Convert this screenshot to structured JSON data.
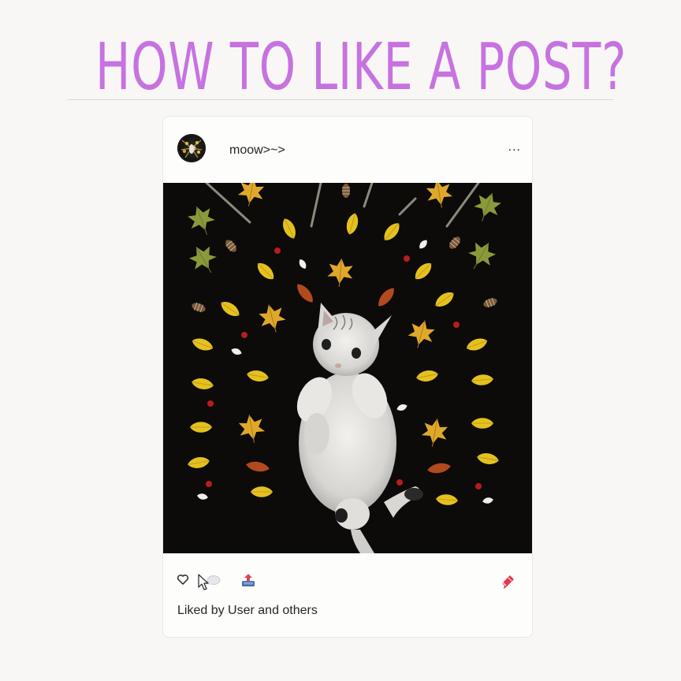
{
  "page": {
    "title": "HOW TO LIKE A POST?"
  },
  "post": {
    "username": "moow>~>",
    "more_label": "...",
    "liked_by": "Liked by User and others",
    "image_subject": "white kitten lying among autumn leaves on black background"
  },
  "icons": {
    "like": "heart-outline-icon",
    "comment": "comment-bubble-icon",
    "share": "share-tray-icon",
    "save": "bookmark-ribbon-icon",
    "cursor": "mouse-pointer-icon"
  },
  "colors": {
    "title": "#c772e1",
    "background": "#f8f7f5",
    "text": "#262626",
    "bookmark": "#e8354b"
  }
}
